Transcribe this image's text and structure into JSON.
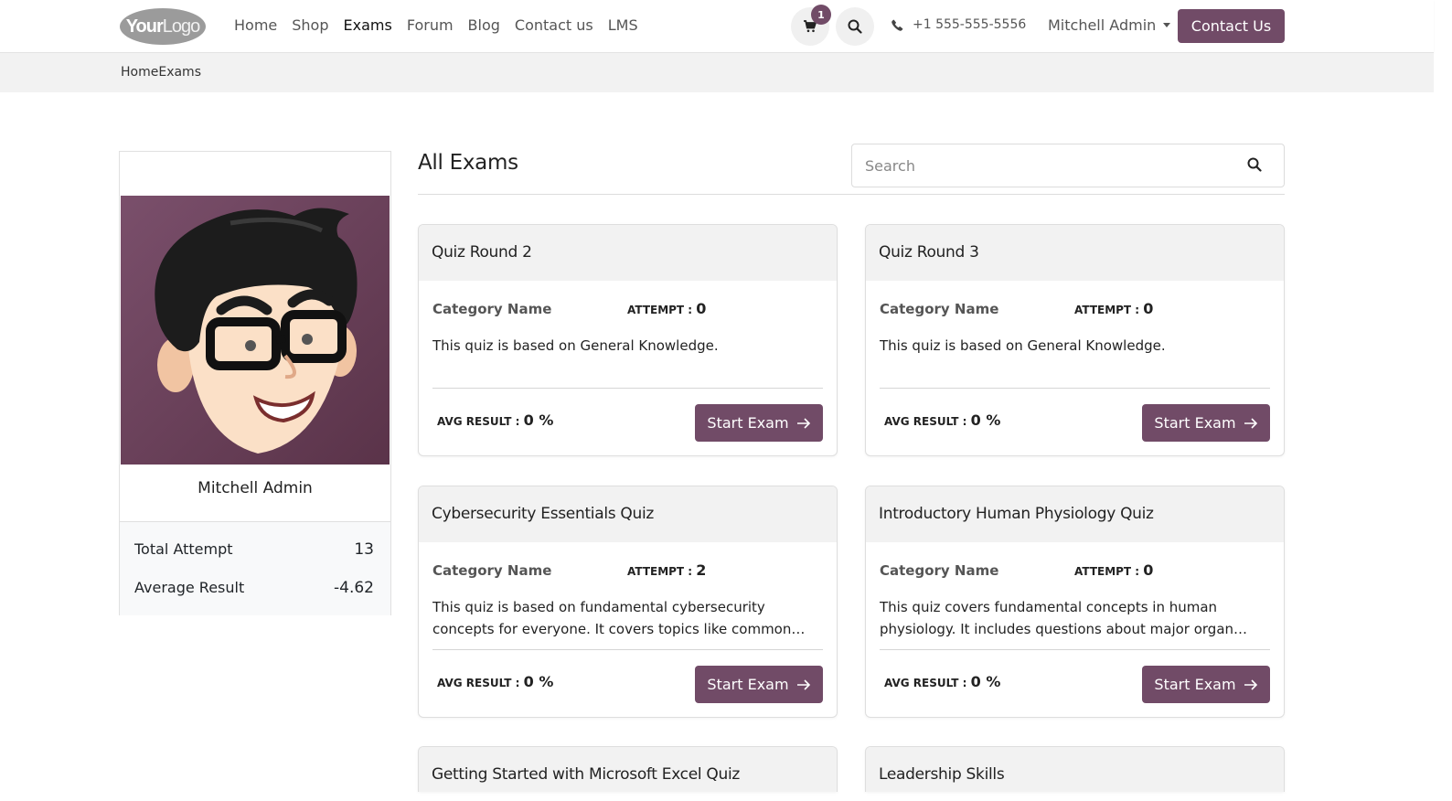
{
  "header": {
    "logo": {
      "bold": "Your",
      "light": "Logo"
    },
    "nav": [
      "Home",
      "Shop",
      "Exams",
      "Forum",
      "Blog",
      "Contact us",
      "LMS"
    ],
    "nav_active": "Exams",
    "cart_count": "1",
    "phone": "+1 555-555-5556",
    "user": "Mitchell Admin",
    "contact_button": "Contact Us"
  },
  "breadcrumb": "HomeExams",
  "profile": {
    "name": "Mitchell Admin",
    "stats": [
      {
        "label": "Total Attempt",
        "value": "13"
      },
      {
        "label": "Average Result",
        "value": "-4.62"
      }
    ]
  },
  "main": {
    "title": "All Exams",
    "search_placeholder": "Search"
  },
  "labels": {
    "attempt": "ATTEMPT : ",
    "avg_result": "AVG RESULT : ",
    "start_exam": "Start Exam"
  },
  "exams": [
    {
      "title": "Quiz Round 2",
      "category": "Category Name",
      "attempts": "0",
      "description": "This quiz is based on General Knowledge.",
      "avg": "0 %"
    },
    {
      "title": "Quiz Round 3",
      "category": "Category Name",
      "attempts": "0",
      "description": "This quiz is based on General Knowledge.",
      "avg": "0 %"
    },
    {
      "title": "Cybersecurity Essentials Quiz",
      "category": "Category Name",
      "attempts": "2",
      "description": "This quiz is based on fundamental cybersecurity concepts for everyone. It covers topics like common threats and safe practices.",
      "avg": "0 %"
    },
    {
      "title": "Introductory Human Physiology Quiz",
      "category": "Category Name",
      "attempts": "0",
      "description": "This quiz covers fundamental concepts in human physiology. It includes questions about major organ systems and functions.",
      "avg": "0 %"
    },
    {
      "title": "Getting Started with Microsoft Excel Quiz",
      "category": "",
      "attempts": "",
      "description": "",
      "avg": ""
    },
    {
      "title": "Leadership Skills",
      "category": "",
      "attempts": "",
      "description": "",
      "avg": ""
    }
  ],
  "colors": {
    "brand": "#714b67",
    "header_bg": "#ffffff",
    "subtle_bg": "#f2f2f2"
  }
}
